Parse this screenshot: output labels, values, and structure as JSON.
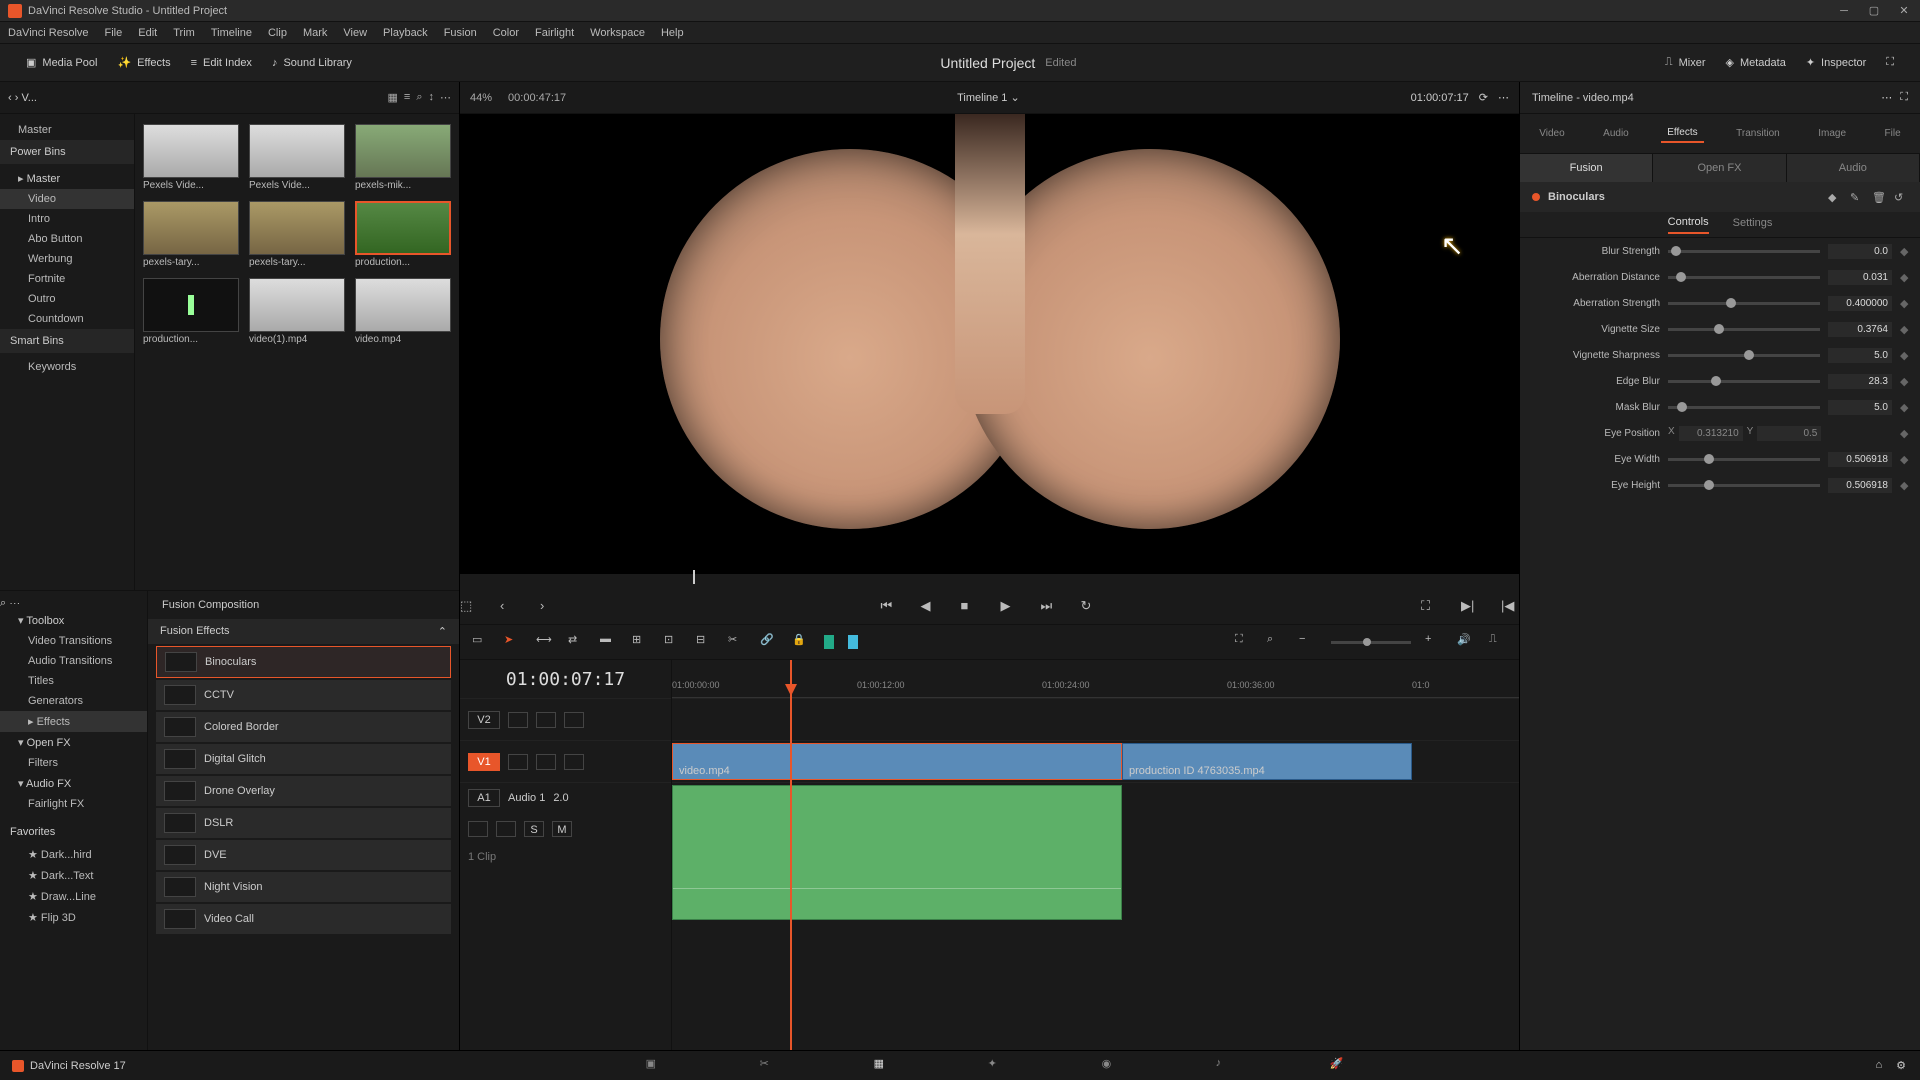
{
  "titlebar": {
    "text": "DaVinci Resolve Studio - Untitled Project"
  },
  "menus": [
    "DaVinci Resolve",
    "File",
    "Edit",
    "Trim",
    "Timeline",
    "Clip",
    "Mark",
    "View",
    "Playback",
    "Fusion",
    "Color",
    "Fairlight",
    "Workspace",
    "Help"
  ],
  "toolbar": {
    "media_pool": "Media Pool",
    "effects": "Effects",
    "edit_index": "Edit Index",
    "sound_library": "Sound Library",
    "project_title": "Untitled Project",
    "project_status": "Edited",
    "mixer": "Mixer",
    "metadata": "Metadata",
    "inspector": "Inspector"
  },
  "browse_top": {
    "bin_label": "V...",
    "zoom": "44%",
    "duration": "00:00:47:17"
  },
  "bins": {
    "master": "Master",
    "power_header": "Power Bins",
    "pb_master": "Master",
    "items": [
      "Video",
      "Intro",
      "Abo Button",
      "Werbung",
      "Fortnite",
      "Outro",
      "Countdown"
    ],
    "smart_header": "Smart Bins",
    "smart_items": [
      "Keywords"
    ]
  },
  "clips": [
    "Pexels Vide...",
    "Pexels Vide...",
    "pexels-mik...",
    "pexels-tary...",
    "pexels-tary...",
    "production...",
    "production...",
    "video(1).mp4",
    "video.mp4"
  ],
  "fx_tree": {
    "toolbox": "Toolbox",
    "items": [
      "Video Transitions",
      "Audio Transitions",
      "Titles",
      "Generators",
      "Effects"
    ],
    "openfx": "Open FX",
    "openfx_items": [
      "Filters"
    ],
    "audiofx": "Audio FX",
    "audiofx_items": [
      "Fairlight FX"
    ],
    "fav_header": "Favorites",
    "favs": [
      "Dark...hird",
      "Dark...Text",
      "Draw...Line",
      "Flip 3D"
    ]
  },
  "fx_list": {
    "comp": "Fusion Composition",
    "section": "Fusion Effects",
    "items": [
      "Binoculars",
      "CCTV",
      "Colored Border",
      "Digital Glitch",
      "Drone Overlay",
      "DSLR",
      "DVE",
      "Night Vision",
      "Video Call"
    ]
  },
  "viewer": {
    "timeline_name": "Timeline 1",
    "source_tc": "01:00:07:17"
  },
  "timeline": {
    "playhead_tc": "01:00:07:17",
    "ticks": [
      "01:00:00:00",
      "01:00:12:00",
      "01:00:24:00",
      "01:00:36:00",
      "01:0"
    ],
    "v2": "V2",
    "v1": "V1",
    "a1": "A1",
    "a1_name": "Audio 1",
    "a1_ch": "2.0",
    "a1_clips": "1 Clip",
    "clip1": "video.mp4",
    "clip2": "production ID 4763035.mp4",
    "solo": "S",
    "mute": "M"
  },
  "inspector": {
    "header": "Timeline - video.mp4",
    "tabs": [
      "Video",
      "Audio",
      "Effects",
      "Transition",
      "Image",
      "File"
    ],
    "subtabs": [
      "Fusion",
      "Open FX",
      "Audio"
    ],
    "effect_name": "Binoculars",
    "subcontrols": [
      "Controls",
      "Settings"
    ],
    "params": [
      {
        "label": "Blur Strength",
        "value": "0.0",
        "pos": 2
      },
      {
        "label": "Aberration Distance",
        "value": "0.031",
        "pos": 5
      },
      {
        "label": "Aberration Strength",
        "value": "0.400000",
        "pos": 38
      },
      {
        "label": "Vignette Size",
        "value": "0.3764",
        "pos": 30
      },
      {
        "label": "Vignette Sharpness",
        "value": "5.0",
        "pos": 50
      },
      {
        "label": "Edge Blur",
        "value": "28.3",
        "pos": 28
      },
      {
        "label": "Mask Blur",
        "value": "5.0",
        "pos": 6
      },
      {
        "label": "Eye Position",
        "x": "0.313210",
        "y": "0.5"
      },
      {
        "label": "Eye Width",
        "value": "0.506918",
        "pos": 24
      },
      {
        "label": "Eye Height",
        "value": "0.506918",
        "pos": 24
      }
    ]
  },
  "bottom": {
    "app": "DaVinci Resolve 17"
  }
}
